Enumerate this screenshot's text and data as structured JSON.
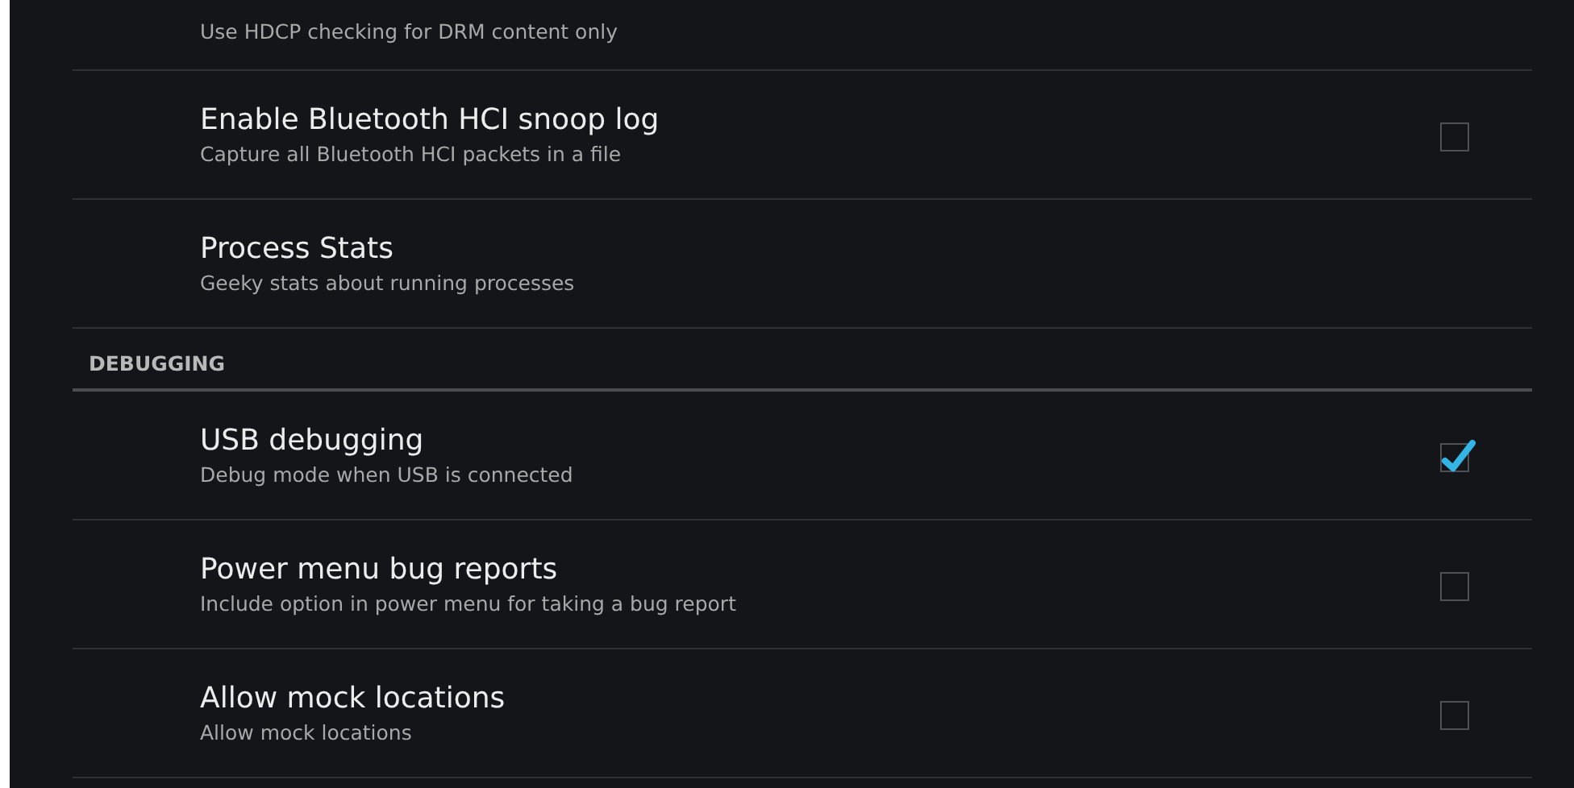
{
  "list": [
    {
      "kind": "item",
      "summary": "Use HDCP checking for DRM content only"
    },
    {
      "kind": "checkbox",
      "title": "Enable Bluetooth HCI snoop log",
      "summary": "Capture all Bluetooth HCI packets in a file",
      "checked": false
    },
    {
      "kind": "item",
      "title": "Process Stats",
      "summary": "Geeky stats about running processes"
    },
    {
      "kind": "header",
      "title": "DEBUGGING"
    },
    {
      "kind": "checkbox",
      "title": "USB debugging",
      "summary": "Debug mode when USB is connected",
      "checked": true
    },
    {
      "kind": "checkbox",
      "title": "Power menu bug reports",
      "summary": "Include option in power menu for taking a bug report",
      "checked": false
    },
    {
      "kind": "checkbox",
      "title": "Allow mock locations",
      "summary": "Allow mock locations",
      "checked": false
    }
  ]
}
